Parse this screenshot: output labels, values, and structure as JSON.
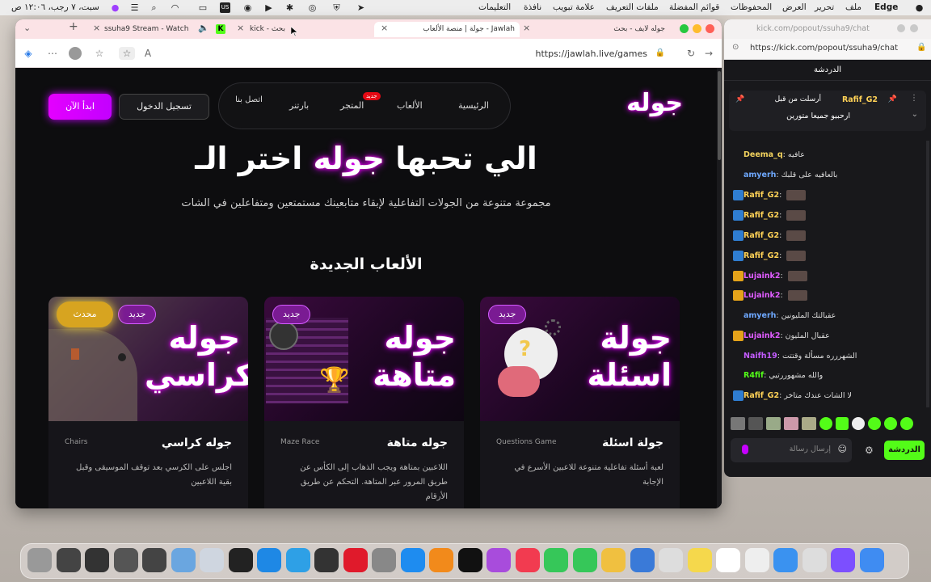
{
  "menubar": {
    "app": "Edge",
    "items": [
      "ملف",
      "تحرير",
      "العرض",
      "المحفوظات",
      "قوائم المفضلة",
      "ملفات التعريف",
      "علامة تبويب",
      "نافذة",
      "التعليمات"
    ],
    "clock": "سبت، ٧ رجب، ١٢:٠٦ ص"
  },
  "browser": {
    "tabs": [
      {
        "title": "جوله لايف - بحث"
      },
      {
        "title": "جولة | منصة الألعاب - Jawlah"
      },
      {
        "title": "kick - بحث"
      },
      {
        "title": "ssuha9 Stream - Watch"
      }
    ],
    "url": "https://jawlah.live/games"
  },
  "site": {
    "logo": "جوله",
    "nav": {
      "home": "الرئيسية",
      "games": "الألعاب",
      "store": "المتجر",
      "partner": "بارتنر",
      "contact": "اتصل بنا"
    },
    "store_badge": "جديد",
    "login_label": "تسجيل الدخول",
    "start_label": "ابدأ الآن",
    "hero_pre": "اختر الـ",
    "hero_highlight": "جوله",
    "hero_post": "الي تحبها",
    "subtitle": "مجموعة متنوعة من الجولات التفاعلية لإبقاء متابعينك مستمتعين ومتفاعلين في الشات",
    "section_title": "الألعاب الجديدة",
    "cards": [
      {
        "art": "جولة اسئلة",
        "badge": "جديد",
        "name": "جولة اسئلة",
        "tag": "Questions Game",
        "desc": "لعبة أسئلة تفاعلية متنوعة للاعبين الأسرع في الإجابة"
      },
      {
        "art": "جوله متاهة",
        "badge": "جديد",
        "name": "جوله متاهة",
        "tag": "Maze Race",
        "desc": "اللاعبين بمتاهة ويجب الذهاب إلى الكأس عن طريق المرور عبر المتاهة. التحكم عن طريق الأرقام"
      },
      {
        "art": "جوله كراسي",
        "badge": "جديد",
        "updated": "محدث",
        "name": "جوله كراسي",
        "tag": "Chairs",
        "desc": "اجلس على الكرسي بعد توقف الموسيقى وقبل بقية اللاعبين"
      }
    ]
  },
  "chat": {
    "title_url": "kick.com/popout/ssuha9/chat",
    "address": "https://kick.com/popout/ssuha9/chat",
    "header": "الدردشة",
    "pinned_by_label": "أرسلت من قبل",
    "pinned_user": "Rafif_G2",
    "pinned_text": "ارحبيو جميعا متورين",
    "messages": [
      {
        "user": "Deema_q",
        "text": "عافيه",
        "color": "#f3d35e"
      },
      {
        "user": "amyerh",
        "text": "بالعافيه على قلبك",
        "color": "#6ea8ff"
      },
      {
        "user": "Rafif_G2",
        "text": "",
        "color": "#ffd257"
      },
      {
        "user": "Rafif_G2",
        "text": "",
        "color": "#ffd257"
      },
      {
        "user": "Rafif_G2",
        "text": "",
        "color": "#ffd257"
      },
      {
        "user": "Rafif_G2",
        "text": "",
        "color": "#ffd257"
      },
      {
        "user": "Lujaink2",
        "text": "",
        "color": "#e05cff"
      },
      {
        "user": "Lujaink2",
        "text": "",
        "color": "#e05cff"
      },
      {
        "user": "amyerh",
        "text": "عقبالتك المليونين",
        "color": "#6ea8ff"
      },
      {
        "user": "Lujaink2",
        "text": "عقبال المليون",
        "color": "#e05cff"
      },
      {
        "user": "Naifh19",
        "text": "الشهررره مسألة وقتتت",
        "color": "#c45cff"
      },
      {
        "user": "R4fif",
        "text": "والله مشهوررتيي",
        "color": "#53fc18"
      },
      {
        "user": "Rafif_G2",
        "text": "لا الشات عندك متاخر",
        "color": "#ffd257"
      }
    ],
    "input_placeholder": "إرسال رسالة",
    "send_label": "الدردشة"
  },
  "colors": {
    "accent": "#d100ff",
    "kick_green": "#53fc18",
    "page_bg": "#0d0d0f"
  }
}
